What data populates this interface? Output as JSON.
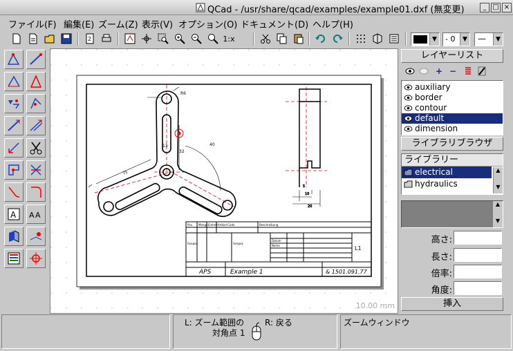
{
  "window": {
    "title": "QCad - /usr/share/qcad/examples/example01.dxf (無変更)",
    "minimize": "_",
    "maximize": "□",
    "close": "×"
  },
  "menu": [
    {
      "label": "ファイル(F)"
    },
    {
      "label": "編集(E)"
    },
    {
      "label": "ズーム(Z)"
    },
    {
      "label": "表示(V)"
    },
    {
      "label": "オプション(O)"
    },
    {
      "label": "ドキュメント(D)"
    },
    {
      "label": "ヘルプ(H)"
    }
  ],
  "toolbar": {
    "zoom_one_label": "1:x",
    "line_width_value": "- 0",
    "line_type_value": "—"
  },
  "layers": {
    "header": "レイヤーリスト",
    "items": [
      {
        "name": "auxiliary",
        "selected": false
      },
      {
        "name": "border",
        "selected": false
      },
      {
        "name": "contour",
        "selected": false
      },
      {
        "name": "default",
        "selected": true
      },
      {
        "name": "dimension",
        "selected": false
      }
    ]
  },
  "library": {
    "browser_header": "ライブラリブラウザ",
    "tree_header": "ライブラリー",
    "items": [
      {
        "name": "electrical",
        "selected": true
      },
      {
        "name": "hydraulics",
        "selected": false
      }
    ],
    "fields": [
      {
        "label": "高さ:",
        "value": ""
      },
      {
        "label": "長さ:",
        "value": ""
      },
      {
        "label": "倍率:",
        "value": ""
      },
      {
        "label": "角度:",
        "value": ""
      }
    ],
    "insert_label": "挿入"
  },
  "canvas": {
    "grid_label": "10.00 mm",
    "titleblock": {
      "left_text": "APS",
      "center_text": "Example 1",
      "right_text": "& 1501.091.77",
      "sheet": "L1"
    }
  },
  "status": {
    "left_line1": "L: ズーム範囲の",
    "left_line2": "対角点 1",
    "right_label": "R: 戻る",
    "command": "ズームウィンドウ"
  },
  "colors": {
    "selection": "#1a2d7a",
    "drawing_accent": "#ff0000",
    "background": "#c8c8c8"
  }
}
